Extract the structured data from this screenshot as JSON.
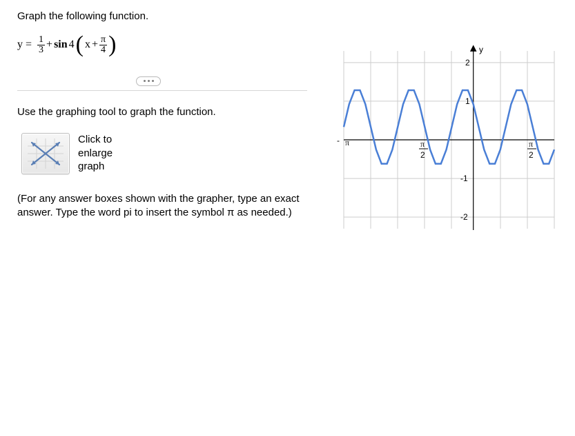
{
  "prompt": "Graph the following function.",
  "equation": {
    "lhs": "y =",
    "frac1_num": "1",
    "frac1_den": "3",
    "plus1": " + ",
    "sin": "sin",
    "coef": " 4",
    "x": "x",
    "plus2": " + ",
    "frac2_num": "π",
    "frac2_den": "4"
  },
  "instruction": "Use the graphing tool to graph the function.",
  "enlarge": {
    "line1": "Click to",
    "line2": "enlarge",
    "line3": "graph"
  },
  "note": "(For any answer boxes shown with the grapher, type an exact answer. Type the word pi to insert the symbol π as needed.)",
  "chart": {
    "y_label": "y",
    "y_ticks": {
      "p2": "2",
      "p1": "1",
      "m1": "-1",
      "m2": "-2"
    },
    "x_ticks": {
      "neg_pi": "π",
      "neg_sign": "-",
      "pos_pi_num": "π",
      "pos_pi_den": "2",
      "pos_pi2_num": "π",
      "pos_pi2_den": "2"
    }
  },
  "chart_data": {
    "type": "line",
    "title": "",
    "xlabel": "",
    "ylabel": "y",
    "xlim": [
      -3.7699,
      2.3562
    ],
    "ylim": [
      -2,
      2
    ],
    "x_ticks_values": [
      -3.1416,
      -1.5708,
      1.5708
    ],
    "x_ticks_labels": [
      "-π",
      "-π/2",
      "π/2"
    ],
    "y_ticks_values": [
      -2,
      -1,
      1,
      2
    ],
    "series": [
      {
        "name": "y = 1/3 + sin(4(x + π/4))",
        "color": "#4a7fd6",
        "x": [
          -3.7699,
          -3.6128,
          -3.4558,
          -3.2987,
          -3.1416,
          -2.9845,
          -2.8274,
          -2.6704,
          -2.5133,
          -2.3562,
          -2.1991,
          -2.042,
          -1.885,
          -1.7279,
          -1.5708,
          -1.4137,
          -1.2566,
          -1.0996,
          -0.9425,
          -0.7854,
          -0.6283,
          -0.4712,
          -0.3142,
          -0.1571,
          0.0,
          0.1571,
          0.3142,
          0.4712,
          0.6283,
          0.7854,
          0.9425,
          1.0996,
          1.2566,
          1.4137,
          1.5708,
          1.7279,
          1.885,
          2.042,
          2.1991,
          2.3562
        ],
        "values": [
          0.333,
          0.921,
          1.284,
          1.284,
          0.921,
          0.333,
          -0.254,
          -0.618,
          -0.618,
          -0.254,
          0.333,
          0.921,
          1.284,
          1.284,
          0.921,
          0.333,
          -0.254,
          -0.618,
          -0.618,
          -0.254,
          0.333,
          0.921,
          1.284,
          1.284,
          0.921,
          0.333,
          -0.254,
          -0.618,
          -0.618,
          -0.254,
          0.333,
          0.921,
          1.284,
          1.284,
          0.921,
          0.333,
          -0.254,
          -0.618,
          -0.618,
          -0.254
        ]
      }
    ]
  }
}
